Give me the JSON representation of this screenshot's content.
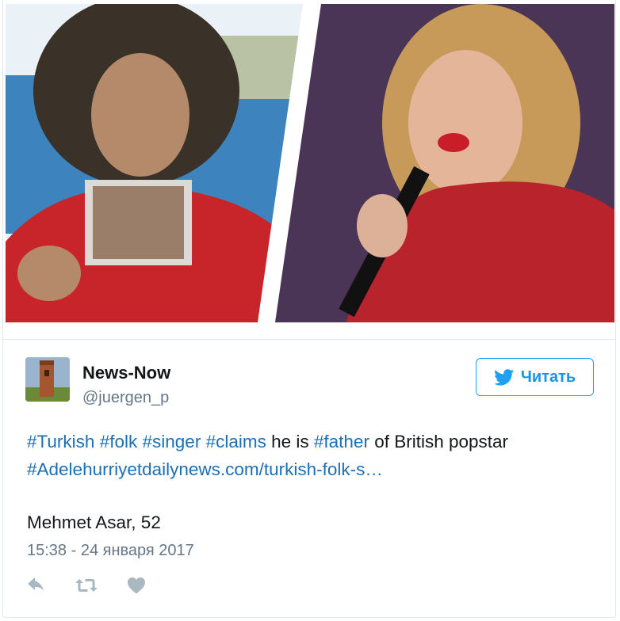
{
  "tweet": {
    "author_name": "News-Now",
    "handle": "@juergen_p",
    "follow_label": "Читать",
    "text": {
      "h1": "#Turkish",
      "h2": "#folk",
      "h3": "#singer",
      "h4": "#claims",
      "t1": " he is ",
      "h5": "#father",
      "t2": " of British popstar",
      "h6": "#Adele",
      "link": "hurriyetdailynews.com/turkish-folk-s…"
    },
    "caption": "Mehmet Asar, 52",
    "timestamp": "15:38 - 24 января 2017"
  },
  "icons": [
    "reply-icon",
    "retweet-icon",
    "like-icon",
    "twitter-bird-icon"
  ],
  "colors": {
    "accent": "#1da1f2",
    "link": "#1b6fb5",
    "muted": "#657786",
    "text": "#14171a",
    "action": "#aab8c2"
  }
}
